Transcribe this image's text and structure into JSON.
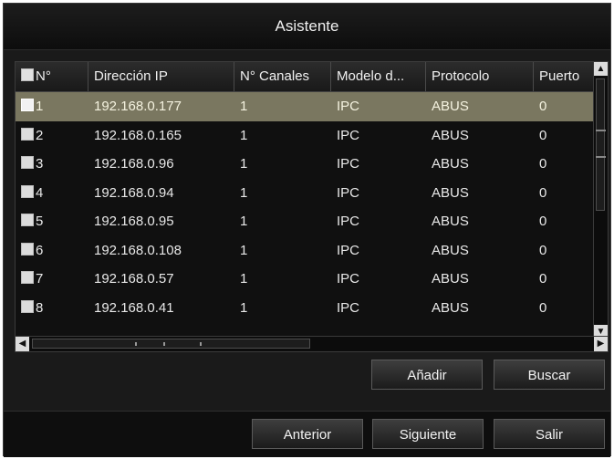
{
  "window": {
    "title": "Asistente"
  },
  "table": {
    "columns": [
      "N°",
      "Dirección IP",
      "N° Canales",
      "Modelo d...",
      "Protocolo",
      "Puerto"
    ],
    "selected_row": 0,
    "rows": [
      {
        "n": "1",
        "ip": "192.168.0.177",
        "channels": "1",
        "model": "IPC",
        "protocol": "ABUS",
        "port": "0"
      },
      {
        "n": "2",
        "ip": "192.168.0.165",
        "channels": "1",
        "model": "IPC",
        "protocol": "ABUS",
        "port": "0"
      },
      {
        "n": "3",
        "ip": "192.168.0.96",
        "channels": "1",
        "model": "IPC",
        "protocol": "ABUS",
        "port": "0"
      },
      {
        "n": "4",
        "ip": "192.168.0.94",
        "channels": "1",
        "model": "IPC",
        "protocol": "ABUS",
        "port": "0"
      },
      {
        "n": "5",
        "ip": "192.168.0.95",
        "channels": "1",
        "model": "IPC",
        "protocol": "ABUS",
        "port": "0"
      },
      {
        "n": "6",
        "ip": "192.168.0.108",
        "channels": "1",
        "model": "IPC",
        "protocol": "ABUS",
        "port": "0"
      },
      {
        "n": "7",
        "ip": "192.168.0.57",
        "channels": "1",
        "model": "IPC",
        "protocol": "ABUS",
        "port": "0"
      },
      {
        "n": "8",
        "ip": "192.168.0.41",
        "channels": "1",
        "model": "IPC",
        "protocol": "ABUS",
        "port": "0"
      }
    ]
  },
  "icons": {
    "scroll_up": "scroll-up-arrow-icon",
    "scroll_down": "scroll-down-arrow-icon",
    "scroll_left": "scroll-left-arrow-icon",
    "scroll_right": "scroll-right-arrow-icon"
  },
  "actions": {
    "add": "Añadir",
    "search": "Buscar"
  },
  "footer": {
    "previous": "Anterior",
    "next": "Siguiente",
    "exit": "Salir"
  },
  "colors": {
    "selected_row": "#7a7760",
    "background": "#1a1a1a"
  }
}
